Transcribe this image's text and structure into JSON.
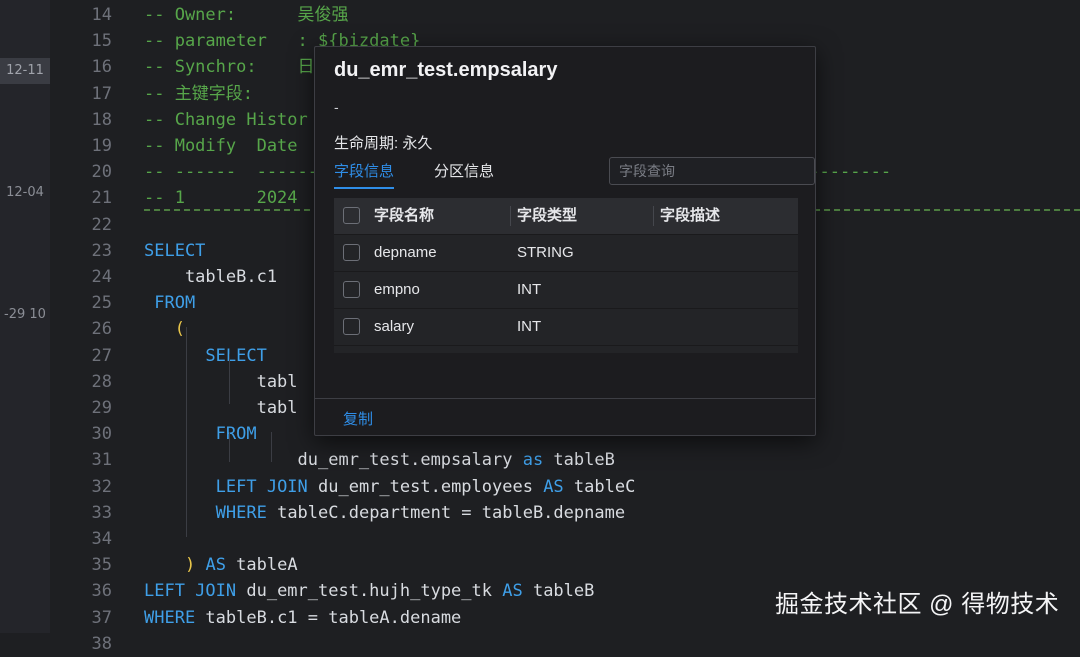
{
  "gutter": {
    "dates": [
      "12-11",
      "12-04",
      "-29 10"
    ]
  },
  "editor": {
    "line_numbers": [
      "14",
      "15",
      "16",
      "17",
      "18",
      "19",
      "20",
      "21",
      "22",
      "23",
      "24",
      "25",
      "26",
      "27",
      "28",
      "29",
      "30",
      "31",
      "32",
      "33",
      "34",
      "35",
      "36",
      "37",
      "38"
    ],
    "lines": [
      [
        {
          "t": "-- Owner:      ",
          "c": "cm"
        },
        {
          "t": "吴俊强",
          "c": "cm"
        }
      ],
      [
        {
          "t": "-- parameter   : ${bizdate}",
          "c": "cm"
        }
      ],
      [
        {
          "t": "-- Synchro:    日增量 / 全量",
          "c": "cm"
        }
      ],
      [
        {
          "t": "-- 主键字段:",
          "c": "cm"
        }
      ],
      [
        {
          "t": "-- Change Histor",
          "c": "cm"
        }
      ],
      [
        {
          "t": "-- Modify  Date",
          "c": "cm"
        }
      ],
      [
        {
          "t": "-- ------  --------------------------------------------------------------",
          "c": "cm"
        }
      ],
      [
        {
          "t": "-- 1       2024",
          "c": "cm"
        }
      ],
      [],
      [
        {
          "t": "SELECT",
          "c": "kw"
        }
      ],
      [
        {
          "t": "    tableB.c1",
          "c": "tx"
        }
      ],
      [
        {
          "t": " FROM",
          "c": "kw"
        }
      ],
      [
        {
          "t": "   (",
          "c": "pr"
        }
      ],
      [
        {
          "t": "      ",
          "c": "tx"
        },
        {
          "t": "SELECT",
          "c": "kw"
        }
      ],
      [
        {
          "t": "           tabl",
          "c": "tx"
        }
      ],
      [
        {
          "t": "           tabl",
          "c": "tx"
        }
      ],
      [
        {
          "t": "       ",
          "c": "tx"
        },
        {
          "t": "FROM",
          "c": "kw"
        }
      ],
      [
        {
          "t": "               du_emr_test.empsalary ",
          "c": "tx"
        },
        {
          "t": "as",
          "c": "kw"
        },
        {
          "t": " tableB",
          "c": "tx"
        }
      ],
      [
        {
          "t": "       ",
          "c": "tx"
        },
        {
          "t": "LEFT JOIN",
          "c": "kw"
        },
        {
          "t": " du_emr_test.employees ",
          "c": "tx"
        },
        {
          "t": "AS",
          "c": "kw"
        },
        {
          "t": " tableC",
          "c": "tx"
        }
      ],
      [
        {
          "t": "       ",
          "c": "tx"
        },
        {
          "t": "WHERE",
          "c": "kw"
        },
        {
          "t": " tableC.department = tableB.depname",
          "c": "tx"
        }
      ],
      [],
      [
        {
          "t": "    ",
          "c": "tx"
        },
        {
          "t": ")",
          "c": "pr"
        },
        {
          "t": " ",
          "c": "tx"
        },
        {
          "t": "AS",
          "c": "kw"
        },
        {
          "t": " tableA",
          "c": "tx"
        }
      ],
      [
        {
          "t": "LEFT JOIN",
          "c": "kw"
        },
        {
          "t": " du_emr_test.hujh_type_tk ",
          "c": "tx"
        },
        {
          "t": "AS",
          "c": "kw"
        },
        {
          "t": " tableB",
          "c": "tx"
        }
      ],
      [
        {
          "t": "WHERE",
          "c": "kw"
        },
        {
          "t": " tableB.c1 = tableA.dename",
          "c": "tx"
        }
      ],
      []
    ]
  },
  "popup": {
    "title": "du_emr_test.empsalary",
    "description": "-",
    "lifecycle": "生命周期: 永久",
    "tabs": [
      {
        "label": "字段信息",
        "active": true
      },
      {
        "label": "分区信息",
        "active": false
      }
    ],
    "search": {
      "placeholder": "字段查询",
      "value": ""
    },
    "table": {
      "columns": [
        "字段名称",
        "字段类型",
        "字段描述"
      ],
      "rows": [
        {
          "name": "depname",
          "type": "STRING",
          "desc": ""
        },
        {
          "name": "empno",
          "type": "INT",
          "desc": ""
        },
        {
          "name": "salary",
          "type": "INT",
          "desc": ""
        }
      ]
    },
    "footer": {
      "copy_label": "复制"
    }
  },
  "watermark": {
    "text": "掘金技术社区 @ 得物技术"
  },
  "colors": {
    "keyword": "#3f9fe8",
    "comment": "#57a64a",
    "text": "#d8dbe0",
    "paren": "#e8c54a",
    "accent": "#2f8ee8"
  }
}
